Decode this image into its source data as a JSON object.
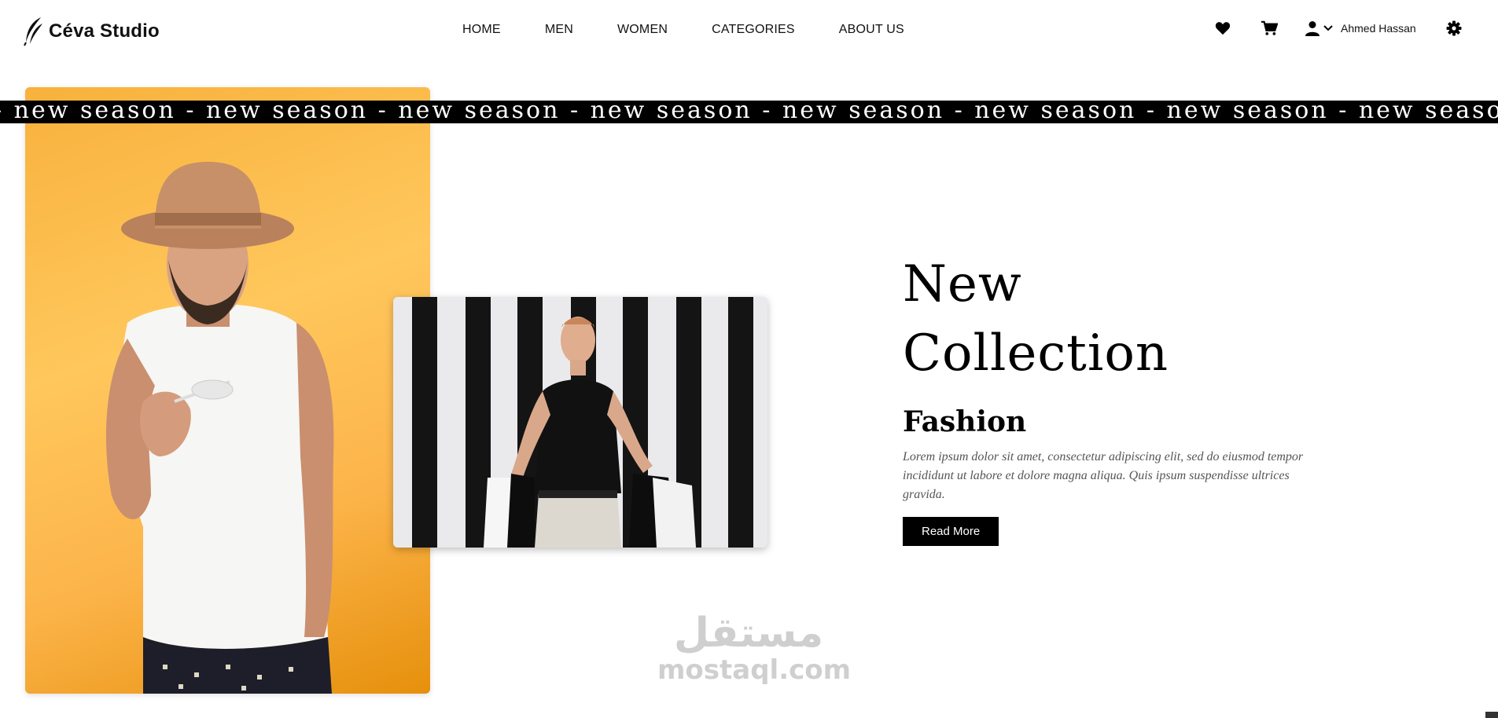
{
  "brand": {
    "name": "Céva Studio"
  },
  "nav": [
    "HOME",
    "MEN",
    "WOMEN",
    "CATEGORIES",
    "ABOUT US"
  ],
  "header": {
    "icons": [
      "heart-icon",
      "cart-icon",
      "user-icon",
      "chevron-down-icon",
      "gear-icon"
    ],
    "user_name": "Ahmed Hassan"
  },
  "marquee": {
    "text": "- new season - new season - new season - new season - new season - new season - new season - new season"
  },
  "hero": {
    "title_line1": "New",
    "title_line2": "Collection",
    "subtitle": "Fashion",
    "description": "Lorem ipsum dolor sit amet, consectetur adipiscing elit, sed do eiusmod tempor incididunt ut labore et dolore magna aliqua. Quis ipsum suspendisse ultrices gravida.",
    "button_label": "Read More",
    "accent_color": "#f9b23e"
  },
  "watermark": {
    "arabic": "مستقل",
    "latin": "mostaql.com"
  }
}
